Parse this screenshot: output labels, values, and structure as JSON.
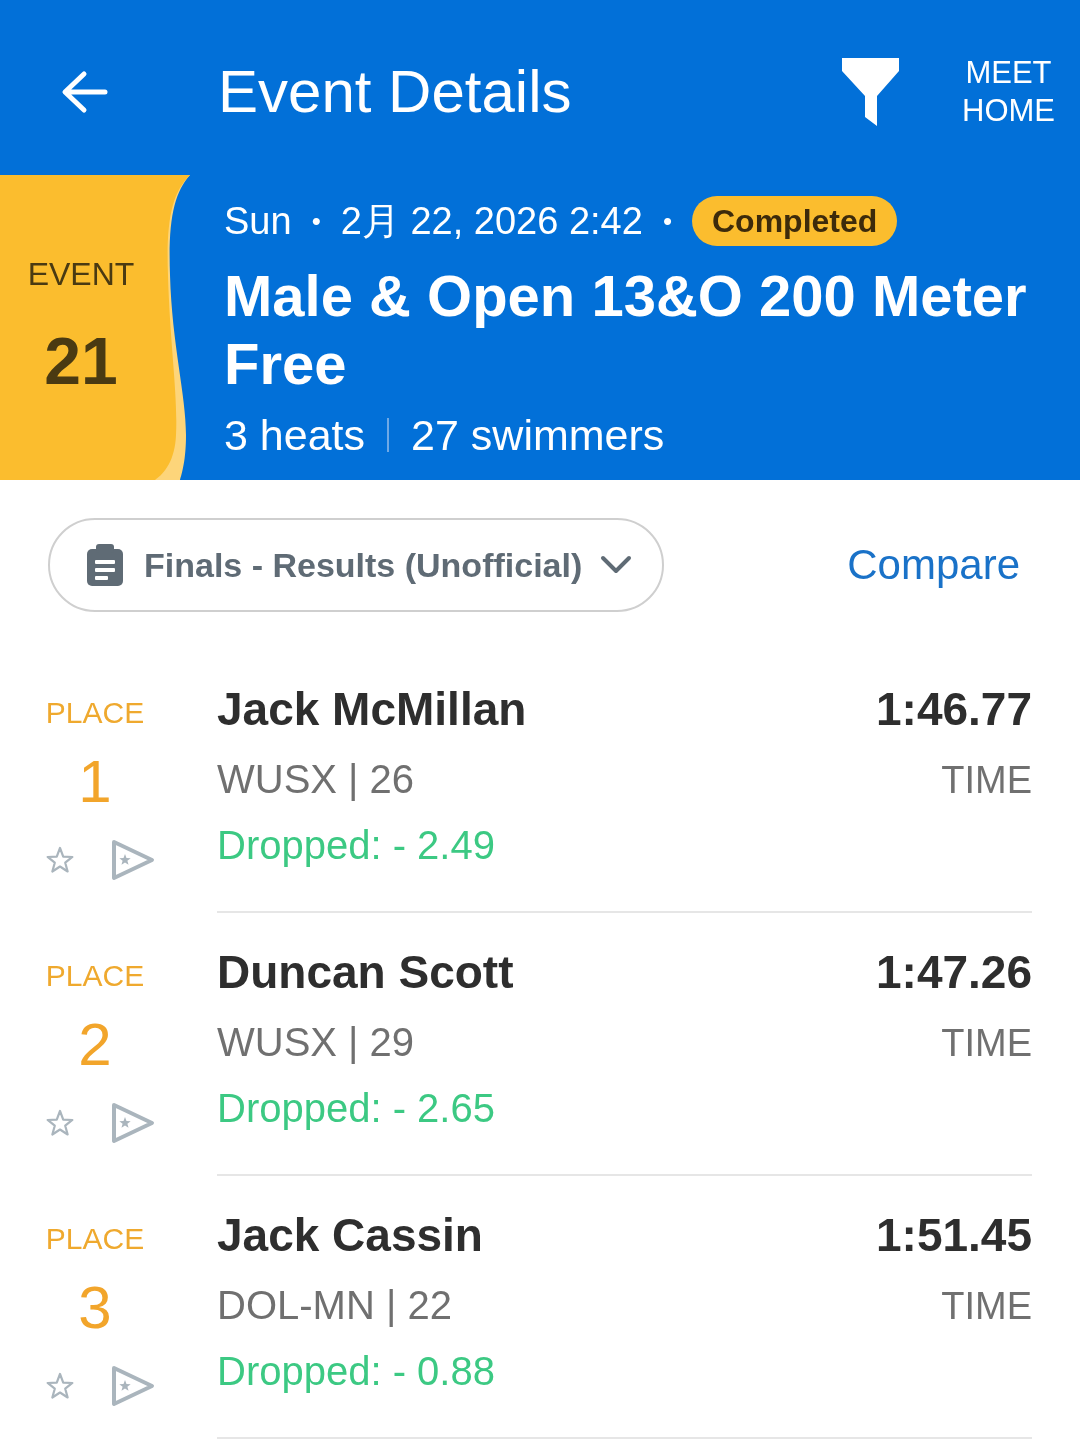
{
  "header": {
    "title": "Event Details",
    "action": "MEET HOME"
  },
  "event": {
    "label": "EVENT",
    "number": "21",
    "meta": [
      {
        "kind": "text",
        "text": "Sun"
      },
      {
        "kind": "dot",
        "text": "•"
      },
      {
        "kind": "text",
        "text": "2月 22, 2026 2:42"
      },
      {
        "kind": "dot",
        "text": "•"
      },
      {
        "kind": "badge",
        "text": "Completed"
      }
    ],
    "title": "Male & Open 13&O 200 Meter Free",
    "stats": [
      "3 heats",
      "27 swimmers"
    ]
  },
  "toolbar": {
    "dropdown": "Finals - Results (Unofficial)",
    "compare": "Compare"
  },
  "results": [
    {
      "place_label": "PLACE",
      "place": "1",
      "starred": false,
      "name": "Jack McMillan",
      "team_age": "WUSX | 26",
      "dropped": "Dropped: - 2.49",
      "time": "1:46.77",
      "time_label": "TIME"
    },
    {
      "place_label": "PLACE",
      "place": "2",
      "starred": false,
      "name": "Duncan Scott",
      "team_age": "WUSX | 29",
      "dropped": "Dropped: - 2.65",
      "time": "1:47.26",
      "time_label": "TIME"
    },
    {
      "place_label": "PLACE",
      "place": "3",
      "starred": false,
      "name": "Jack Cassin",
      "team_age": "DOL-MN | 22",
      "dropped": "Dropped: - 0.88",
      "time": "1:51.45",
      "time_label": "TIME"
    }
  ]
}
